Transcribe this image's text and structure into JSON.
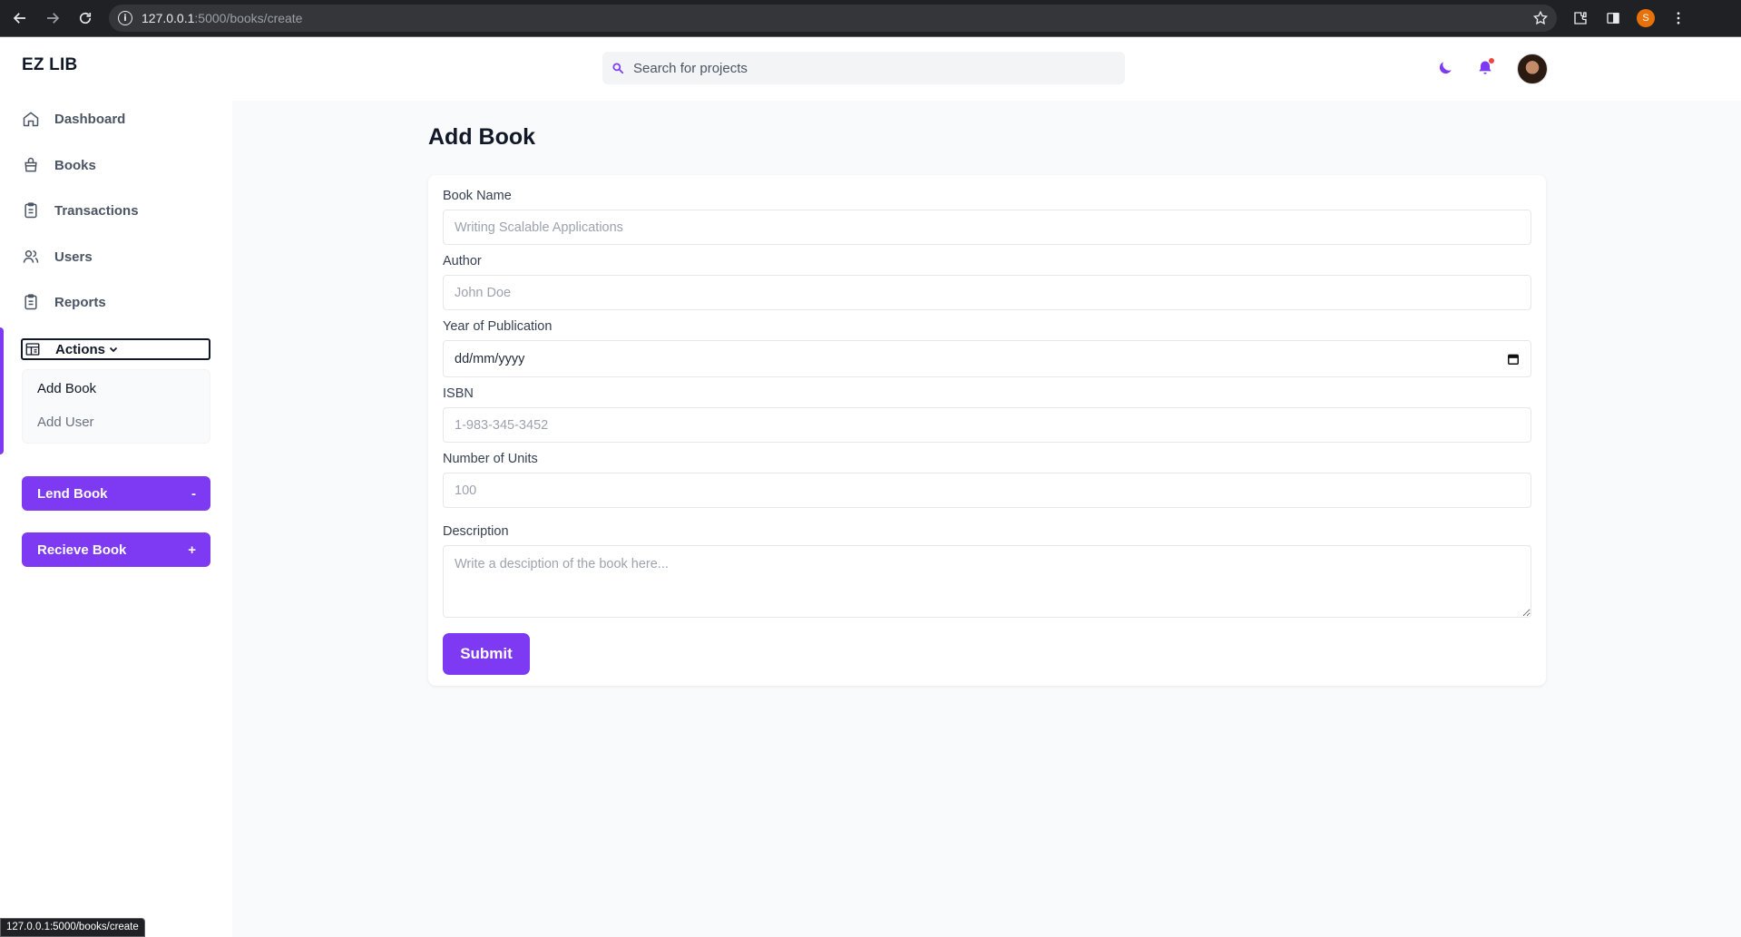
{
  "browser": {
    "url_host": "127.0.0.1",
    "url_path": ":5000/books/create",
    "profile_initial": "S",
    "status_url": "127.0.0.1:5000/books/create"
  },
  "header": {
    "brand": "EZ LIB",
    "search_placeholder": "Search for projects"
  },
  "sidebar": {
    "items": [
      {
        "label": "Dashboard",
        "icon": "home-icon"
      },
      {
        "label": "Books",
        "icon": "shopping-bag-icon"
      },
      {
        "label": "Transactions",
        "icon": "clipboard-icon"
      },
      {
        "label": "Users",
        "icon": "users-icon"
      },
      {
        "label": "Reports",
        "icon": "clipboard-icon"
      }
    ],
    "actions_label": "Actions",
    "submenu": [
      {
        "label": "Add Book"
      },
      {
        "label": "Add User"
      }
    ],
    "lend_label": "Lend Book",
    "lend_symbol": "-",
    "receive_label": "Recieve Book",
    "receive_symbol": "+"
  },
  "form": {
    "title": "Add Book",
    "fields": {
      "book_name": {
        "label": "Book Name",
        "placeholder": "Writing Scalable Applications"
      },
      "author": {
        "label": "Author",
        "placeholder": "John Doe"
      },
      "year": {
        "label": "Year of Publication",
        "value": "dd/mm/yyyy"
      },
      "isbn": {
        "label": "ISBN",
        "placeholder": "1-983-345-3452"
      },
      "units": {
        "label": "Number of Units",
        "placeholder": "100"
      },
      "description": {
        "label": "Description",
        "placeholder": "Write a desciption of the book here..."
      }
    },
    "submit_label": "Submit"
  },
  "colors": {
    "accent": "#7e3af2",
    "notification_dot": "#ef4444"
  }
}
